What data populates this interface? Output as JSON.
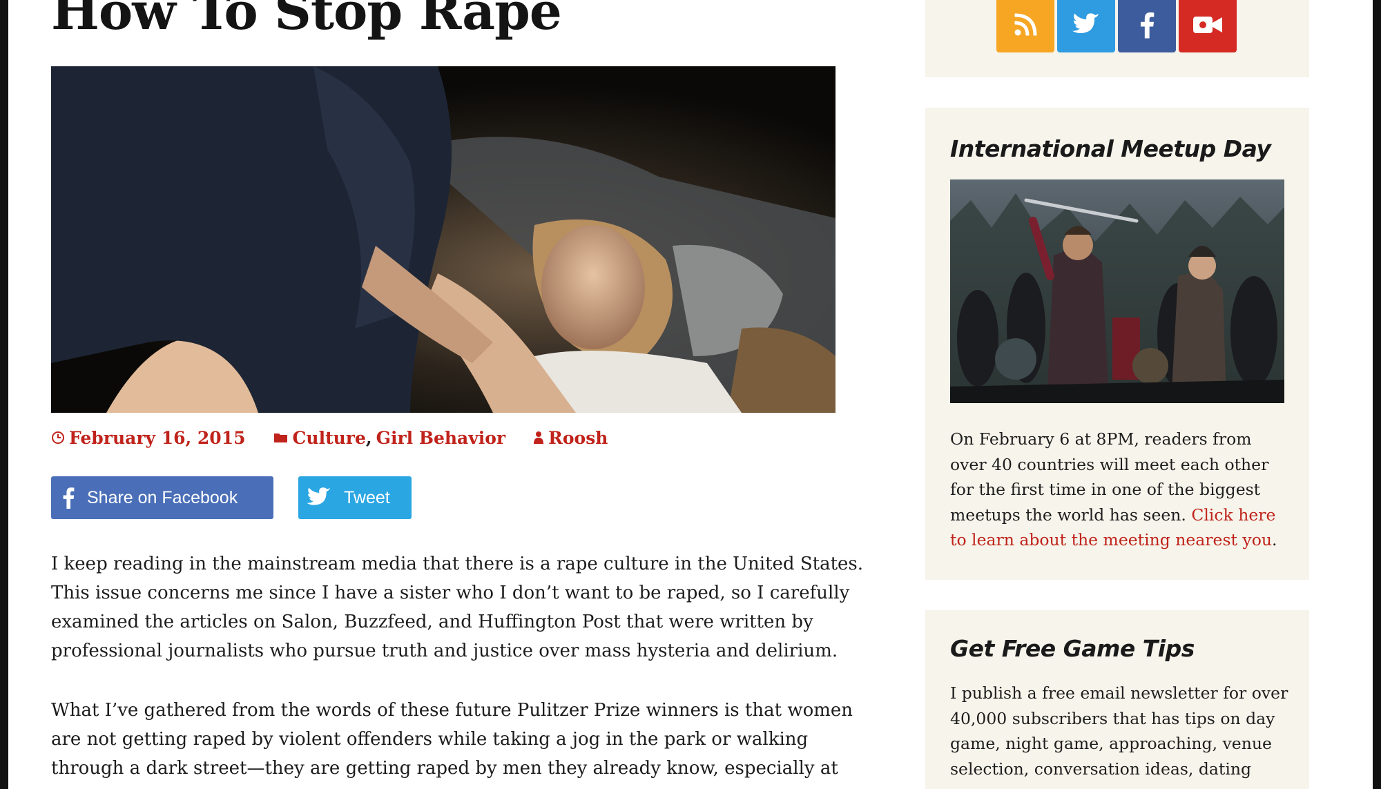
{
  "post": {
    "title": "How To Stop Rape",
    "featured_image_alt": "",
    "meta": {
      "date": "February 16, 2015",
      "category_1": "Culture",
      "category_separator": ",",
      "category_2": "Girl Behavior",
      "author": "Roosh",
      "date_icon": "clock-icon",
      "category_icon": "folder-icon",
      "author_icon": "user-icon"
    },
    "share": {
      "facebook_label": "Share on Facebook",
      "twitter_label": "Tweet"
    },
    "paragraphs": [
      "I keep reading in the mainstream media that there is a rape culture in the United States. This issue concerns me since I have a sister who I don’t want to be raped, so I carefully examined the articles on Salon, Buzzfeed, and Huffington Post that were written by professional journalists who pursue truth and justice over mass hysteria and delirium.",
      "What I’ve gathered from the words of these future Pulitzer Prize winners is that women are not getting raped by violent offenders while taking a jog in the park or walking through a dark street—they are getting raped by men they already know, especially at"
    ]
  },
  "sidebar": {
    "social": {
      "icons": [
        "rss-icon",
        "twitter-icon",
        "facebook-icon",
        "video-camera-icon"
      ],
      "colors": [
        "#f6a623",
        "#2f9be0",
        "#3d5c9e",
        "#d42a23"
      ]
    },
    "meetup": {
      "title": "International Meetup Day",
      "text": "On February 6 at 8PM, readers from over 40 countries will meet each other for the first time in one of the biggest meetups the world has seen. ",
      "link": "Click here to learn about the meeting nearest you",
      "after_link": "."
    },
    "tips": {
      "title": "Get Free Game Tips",
      "text": "I publish a free email newsletter for over 40,000 subscribers that has tips on day game, night game, approaching, venue selection, conversation ideas, dating"
    }
  },
  "colors": {
    "accent": "#c0231b",
    "sidebar_bg": "#f6f4eb",
    "facebook": "#4a6fb8",
    "twitter": "#2aa6e3"
  }
}
